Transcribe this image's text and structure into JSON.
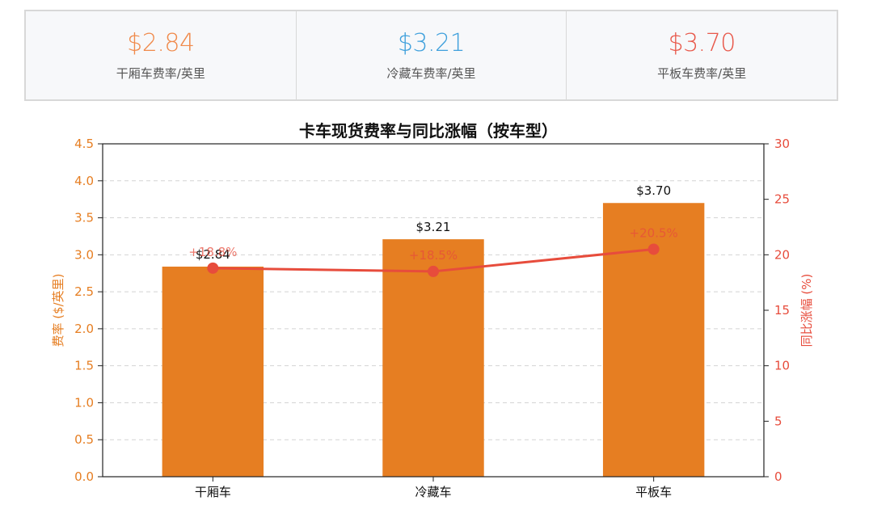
{
  "kpis": [
    {
      "value": "$2.84",
      "label": "干厢车费率/英里",
      "color": "#f08a4b"
    },
    {
      "value": "$3.21",
      "label": "冷藏车费率/英里",
      "color": "#3fa0dc"
    },
    {
      "value": "$3.70",
      "label": "平板车费率/英里",
      "color": "#e8584a"
    }
  ],
  "chart_data": {
    "type": "bar",
    "title": "卡车现货费率与同比涨幅（按车型）",
    "categories": [
      "干厢车",
      "冷藏车",
      "平板车"
    ],
    "series": [
      {
        "name": "",
        "kind": "bar",
        "axis": "left",
        "values": [
          2.84,
          3.21,
          3.7
        ],
        "labels": [
          "$2.84",
          "$3.21",
          "$3.70"
        ]
      },
      {
        "name": "",
        "kind": "line",
        "axis": "right",
        "values": [
          18.8,
          18.5,
          20.5
        ],
        "labels": [
          "+18.8%",
          "+18.5%",
          "+20.5%"
        ]
      }
    ],
    "ylabel": "费率 ($/英里)",
    "y2label": "同比涨幅 (%)",
    "ylim": [
      0,
      4.5
    ],
    "y2lim": [
      0,
      30
    ],
    "yticks": [
      0.0,
      0.5,
      1.0,
      1.5,
      2.0,
      2.5,
      3.0,
      3.5,
      4.0,
      4.5
    ],
    "y2ticks": [
      0,
      5,
      10,
      15,
      20,
      25,
      30
    ],
    "grid": true,
    "colors": {
      "bar": "#e67e22",
      "line": "#e74c3c",
      "left_axis": "#e67e22",
      "right_axis": "#e74c3c"
    }
  }
}
